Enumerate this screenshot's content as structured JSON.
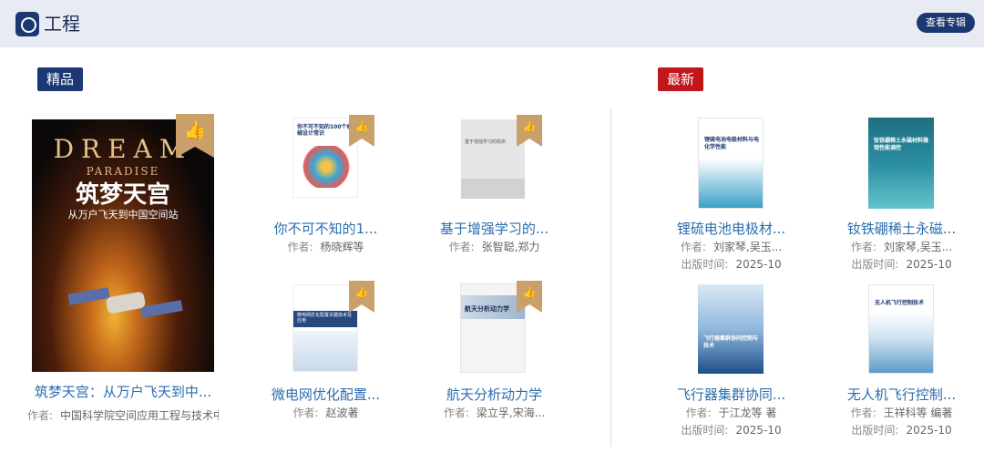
{
  "header": {
    "title": "工程",
    "view_label": "查看专辑"
  },
  "featured": {
    "tag": "精品",
    "main": {
      "cover_top": "DREAM",
      "cover_sub": "PARADISE",
      "cover_title": "筑梦天宫",
      "cover_subtitle": "从万户飞天到中国空间站",
      "title": "筑梦天宫：从万户飞天到中...",
      "author_label": "作者:",
      "author": "中国科学院空间应用工程与技术中..."
    },
    "books": [
      {
        "title": "你不可不知的1...",
        "author_label": "作者:",
        "author": "杨晓辉等",
        "cover_text": "你不可不知的100个机械设计常识"
      },
      {
        "title": "基于增强学习的...",
        "author_label": "作者:",
        "author": "张智聪,郑力",
        "cover_text": "基于增强学习的机床"
      },
      {
        "title": "微电网优化配置...",
        "author_label": "作者:",
        "author": "赵波著",
        "cover_text": "微电网优化配置关键技术及应用"
      },
      {
        "title": "航天分析动力学",
        "author_label": "作者:",
        "author": "梁立孚,宋海...",
        "cover_text": "航天分析动力学"
      }
    ]
  },
  "latest": {
    "tag": "最新",
    "books": [
      {
        "title": "锂硫电池电极材...",
        "author_label": "作者:",
        "author": "刘家琴,吴玉...",
        "date_label": "出版时间:",
        "date": "2025-10",
        "cover_text": "锂硫电池电极材料与电化学性能"
      },
      {
        "title": "钕铁硼稀土永磁...",
        "author_label": "作者:",
        "author": "刘家琴,吴玉...",
        "date_label": "出版时间:",
        "date": "2025-10",
        "cover_text": "钕铁硼稀土永磁材料微观性能调控"
      },
      {
        "title": "飞行器集群协同...",
        "author_label": "作者:",
        "author": "于江龙等 著",
        "date_label": "出版时间:",
        "date": "2025-10",
        "cover_text": "飞行器集群协同控制与技术"
      },
      {
        "title": "无人机飞行控制...",
        "author_label": "作者:",
        "author": "王祥科等 编著",
        "date_label": "出版时间:",
        "date": "2025-10",
        "cover_text": "无人机飞行控制技术"
      }
    ]
  },
  "colors": {
    "primary": "#1c3872",
    "accent_red": "#c0161c",
    "link": "#2b6db0",
    "badge": "#c9a06a"
  }
}
